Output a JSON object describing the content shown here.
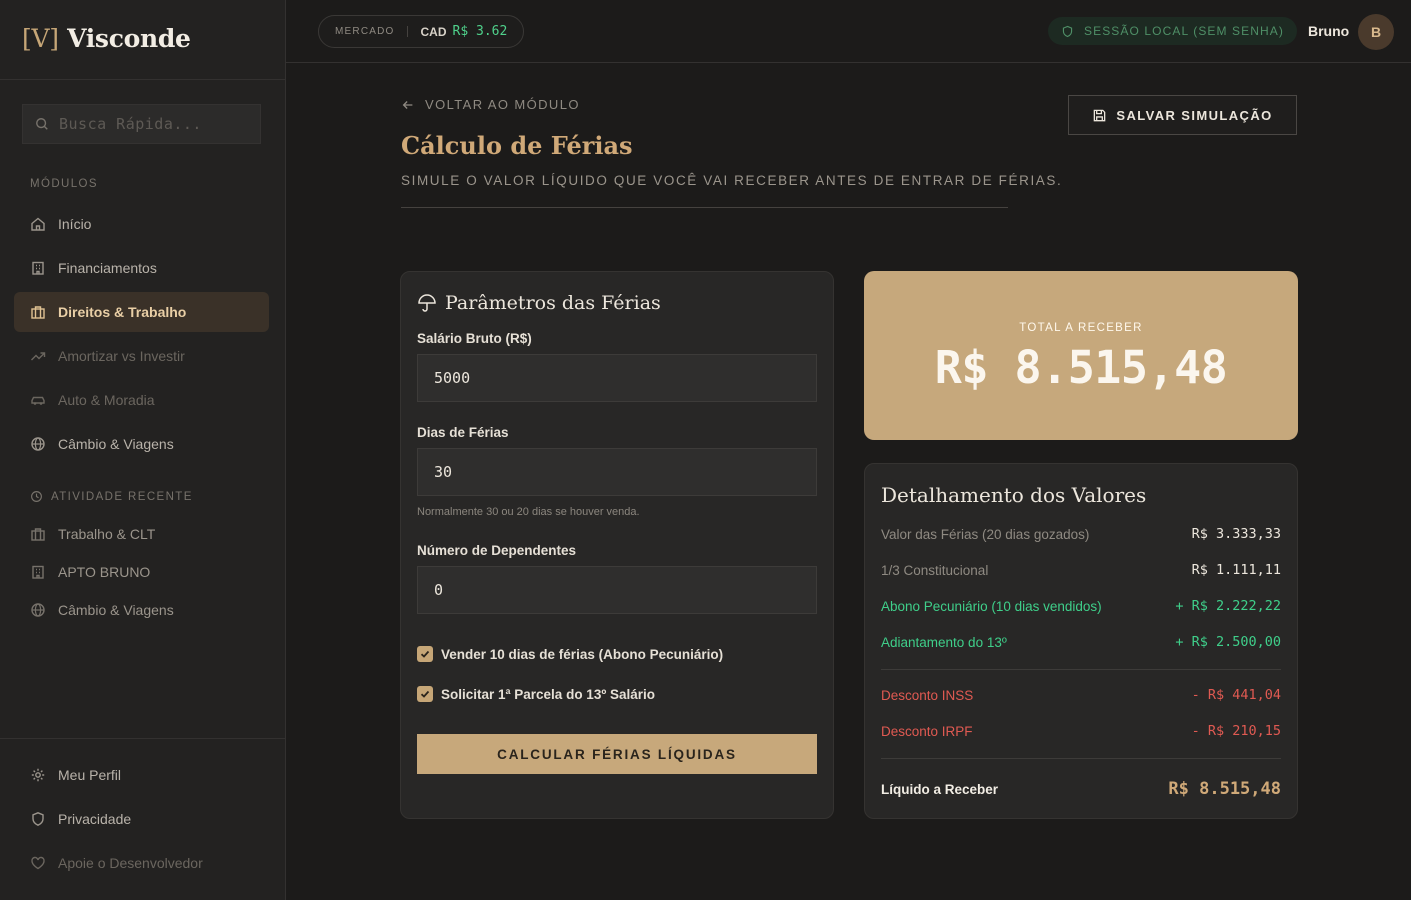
{
  "app": {
    "logo_bracket": "[V]",
    "logo_name": "Visconde"
  },
  "search": {
    "placeholder": "Busca Rápida..."
  },
  "sidebar": {
    "modules_heading": "MÓDULOS",
    "items": [
      {
        "label": "Início",
        "icon": "home-icon",
        "state": "normal"
      },
      {
        "label": "Financiamentos",
        "icon": "building-icon",
        "state": "normal"
      },
      {
        "label": "Direitos & Trabalho",
        "icon": "briefcase-icon",
        "state": "active"
      },
      {
        "label": "Amortizar vs Investir",
        "icon": "trend-up-icon",
        "state": "dim"
      },
      {
        "label": "Auto & Moradia",
        "icon": "car-icon",
        "state": "dim"
      },
      {
        "label": "Câmbio & Viagens",
        "icon": "globe-icon",
        "state": "normal"
      }
    ],
    "recent_heading": "ATIVIDADE RECENTE",
    "recent": [
      {
        "label": "Trabalho & CLT",
        "icon": "briefcase-icon"
      },
      {
        "label": "APTO BRUNO",
        "icon": "building-icon"
      },
      {
        "label": "Câmbio & Viagens",
        "icon": "globe-icon"
      }
    ],
    "footer": [
      {
        "label": "Meu Perfil",
        "icon": "gear-icon"
      },
      {
        "label": "Privacidade",
        "icon": "shield-icon"
      },
      {
        "label": "Apoie o Desenvolvedor",
        "icon": "heart-icon"
      }
    ]
  },
  "topbar": {
    "market_label": "MERCADO",
    "currency": "CAD",
    "rate": "R$ 3.62",
    "session": "SESSÃO LOCAL (SEM SENHA)",
    "user_name": "Bruno",
    "avatar_initial": "B"
  },
  "header": {
    "back": "VOLTAR AO MÓDULO",
    "title": "Cálculo de Férias",
    "subtitle": "SIMULE O VALOR LÍQUIDO QUE VOCÊ VAI RECEBER ANTES DE ENTRAR DE FÉRIAS.",
    "save": "SALVAR SIMULAÇÃO"
  },
  "form": {
    "title": "Parâmetros das Férias",
    "salary_label": "Salário Bruto (R$)",
    "salary_value": "5000",
    "days_label": "Dias de Férias",
    "days_value": "30",
    "days_hint": "Normalmente 30 ou 20 dias se houver venda.",
    "deps_label": "Número de Dependentes",
    "deps_value": "0",
    "check_sell": "Vender 10 dias de férias (Abono Pecuniário)",
    "check_13": "Solicitar 1ª Parcela do 13º Salário",
    "calc_button": "CALCULAR FÉRIAS LÍQUIDAS"
  },
  "total": {
    "label": "TOTAL A RECEBER",
    "value": "R$ 8.515,48"
  },
  "detail": {
    "title": "Detalhamento dos Valores",
    "rows": [
      {
        "label": "Valor das Férias (20 dias gozados)",
        "value": "R$ 3.333,33"
      },
      {
        "label": "1/3 Constitucional",
        "value": "R$ 1.111,11"
      },
      {
        "label": "Abono Pecuniário (10 dias vendidos)",
        "value": "+ R$ 2.222,22"
      },
      {
        "label": "Adiantamento do 13º",
        "value": "+ R$ 2.500,00"
      },
      {
        "label": "Desconto INSS",
        "value": "- R$ 441,04"
      },
      {
        "label": "Desconto IRPF",
        "value": "- R$ 210,15"
      }
    ],
    "net_label": "Líquido a Receber",
    "net_value": "R$ 8.515,48"
  },
  "colors": {
    "accent": "#c6a677",
    "positive": "#3fcf8a",
    "negative": "#e05a52",
    "background": "#1c1b1a"
  }
}
